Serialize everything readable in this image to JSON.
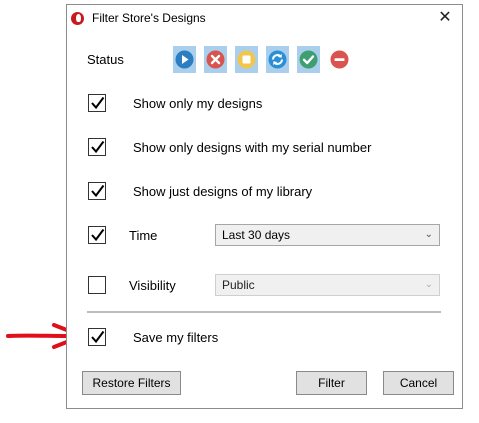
{
  "window": {
    "title": "Filter Store's Designs",
    "close_glyph": "✕"
  },
  "status": {
    "label": "Status",
    "icons": [
      {
        "name": "play-status-icon",
        "color": "#2b7ec1",
        "selected": true
      },
      {
        "name": "cancel-status-icon",
        "color": "#d9534f",
        "selected": true
      },
      {
        "name": "pause-status-icon",
        "color": "#f0c64d",
        "selected": true
      },
      {
        "name": "refresh-status-icon",
        "color": "#2b8fd6",
        "selected": true
      },
      {
        "name": "approved-status-icon",
        "color": "#3f9f72",
        "selected": true
      },
      {
        "name": "blocked-status-icon",
        "color": "#d9534f",
        "selected": false
      }
    ]
  },
  "filters": {
    "only_mine": {
      "label": "Show only my designs",
      "checked": true
    },
    "serial": {
      "label": "Show only designs with my serial number",
      "checked": true
    },
    "library": {
      "label": "Show just designs of my library",
      "checked": true
    },
    "time": {
      "label": "Time",
      "checked": true,
      "value": "Last 30 days"
    },
    "visibility": {
      "label": "Visibility",
      "checked": false,
      "value": "Public"
    },
    "save": {
      "label": "Save my filters",
      "checked": true
    }
  },
  "buttons": {
    "restore": "Restore Filters",
    "filter": "Filter",
    "cancel": "Cancel"
  },
  "colors": {
    "accent_tile": "#aacfec",
    "annotation_arrow": "#e0101a"
  }
}
